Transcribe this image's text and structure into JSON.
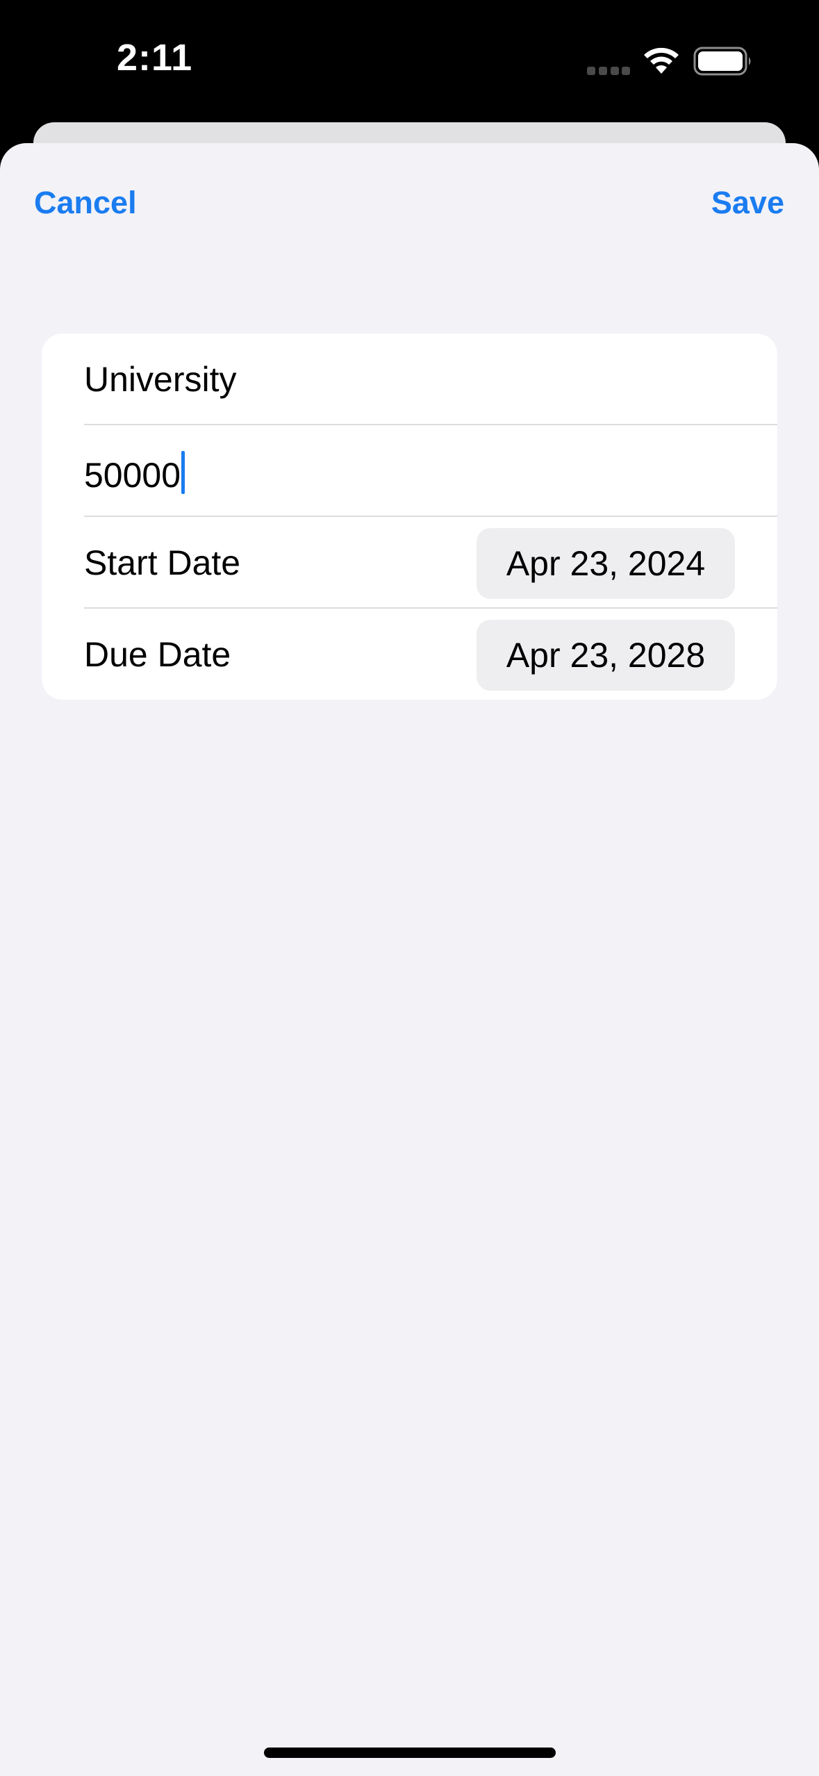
{
  "status_bar": {
    "time": "2:11",
    "icons": [
      "signal-icon",
      "wifi-icon",
      "battery-icon"
    ]
  },
  "nav": {
    "cancel_label": "Cancel",
    "save_label": "Save",
    "accent_color": "#1a7cf0"
  },
  "form": {
    "name_value": "University",
    "amount_value": "50000",
    "start_date_label": "Start Date",
    "start_date_value": "Apr 23, 2024",
    "due_date_label": "Due Date",
    "due_date_value": "Apr 23, 2028"
  }
}
